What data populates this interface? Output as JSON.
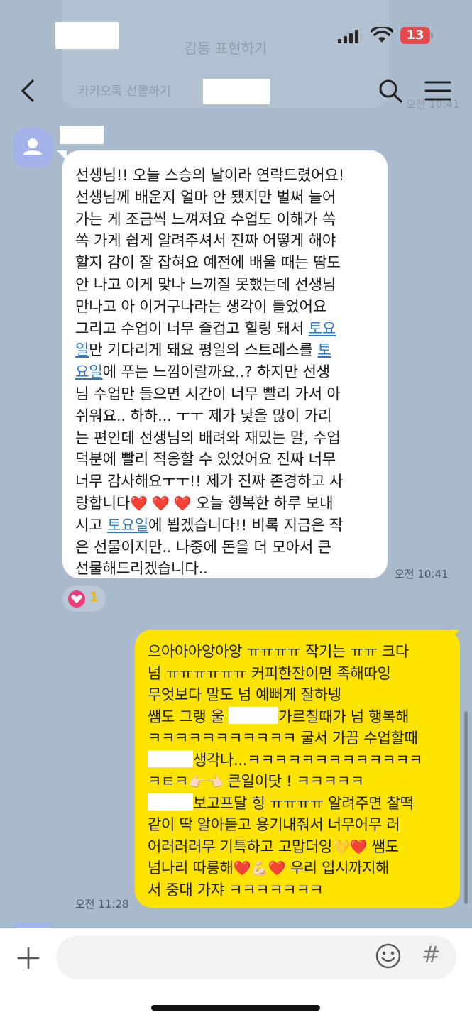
{
  "status_bar": {
    "battery": "13"
  },
  "overlay": {
    "line1": "감동 표현하기",
    "line2": "카카오톡 선물하기",
    "time": "오전 10:41"
  },
  "header": {
    "back_icon": "chevron-left-icon",
    "search_icon": "search-icon",
    "menu_icon": "hamburger-menu-icon"
  },
  "received": {
    "lines": [
      [
        "선생님!! 오늘 스승의 날이라 연락드렸어요!"
      ],
      [
        "선생님께 배운지 얼마 안 됐지만 벌써 늘어"
      ],
      [
        "가는 게 조금씩 느껴져요 수업도 이해가 쏙"
      ],
      [
        "쏙 가게 쉽게 알려주셔서 진짜 어떻게 해야"
      ],
      [
        "할지 감이 잘 잡혀요 예전에 배울 때는 땀도"
      ],
      [
        "안 나고 이게 맞나 느끼질 못했는데 선생님"
      ],
      [
        "만나고 아 이거구나라는 생각이 들었어요"
      ],
      [
        "그리고 수업이 너무 즐겁고 힐링 돼서 ",
        "토요"
      ],
      [
        "일",
        "만 기다리게 돼요 평일의 스트레스를 ",
        "토"
      ],
      [
        "요일",
        "에 푸는 느낌이랄까요..? 하지만 선생"
      ],
      [
        "님 수업만 들으면 시간이 너무 빨리 가서 아"
      ],
      [
        "쉬워요.. 하하... ㅜㅜ 제가 낯을 많이 가리"
      ],
      [
        "는 편인데 선생님의 배려와 재밌는 말, 수업"
      ],
      [
        "덕분에 빨리 적응할 수 있었어요 진짜 너무"
      ],
      [
        "너무 감사해요ㅜㅜ!! 제가 진짜 존경하고 사"
      ],
      [
        "랑합니다",
        " 오늘 행복한 하루 보내"
      ],
      [
        "시고 ",
        "토요일",
        "에 뵙겠습니다!! 비록 지금은 작"
      ],
      [
        "은 선물이지만.. 나중에 돈을 더 모아서 큰"
      ],
      [
        "선물해드리겠습니다.."
      ]
    ],
    "hearts": "❤️ ❤️ ❤️",
    "time": "오전 10:41",
    "reaction_count": "1"
  },
  "sent": {
    "line1": "으아아아앙아앙 ㅠㅠㅠㅠ 작기는 ㅠㅠ 크다",
    "line2": "넘 ㅠㅠㅠㅠㅠㅠ 커피한잔이면 족해따잉",
    "line3": "무엇보다 말도 넘 예뻐게 잘하넹",
    "line4a": "쌤도 그랭 울 ",
    "line4b": "가르칠때가 넘 행복해",
    "line5": "ㅋㅋㅋㅋㅋㅋㅋㅋㅋㅋㅋ 굴서 가끔 수업할때",
    "line6": "생각나...ㅋㅋㅋㅋㅋㅋㅋㅋㅋㅋㅋㅋㅋ",
    "line7a": "ㅋㅌㅋ",
    "line7_emoji": "👉🏻👈🏻",
    "line7b": " 큰일이닷 ! ㅋㅋㅋㅋㅋ",
    "line8": "보고프달 힝 ㅠㅠㅠㅠ 알려주면 찰떡",
    "line9": "같이 딱 알아듣고 용기내줘서 너무어무 러",
    "line10a": "어러러러무 기특하고 고맙더잉",
    "line10_emoji": "💛❤️",
    "line10b": " 쌤도",
    "line11a": "넘나리 따릉해",
    "line11_emoji": "❤️💪🏻❤️",
    "line11b": " 우리 입시까지해",
    "line12": "서 중대 가쟈 ㅋㅋㅋㅋㅋㅋㅋ",
    "time": "오전 11:28"
  },
  "composer": {
    "input_value": "",
    "hash_label": "#"
  }
}
